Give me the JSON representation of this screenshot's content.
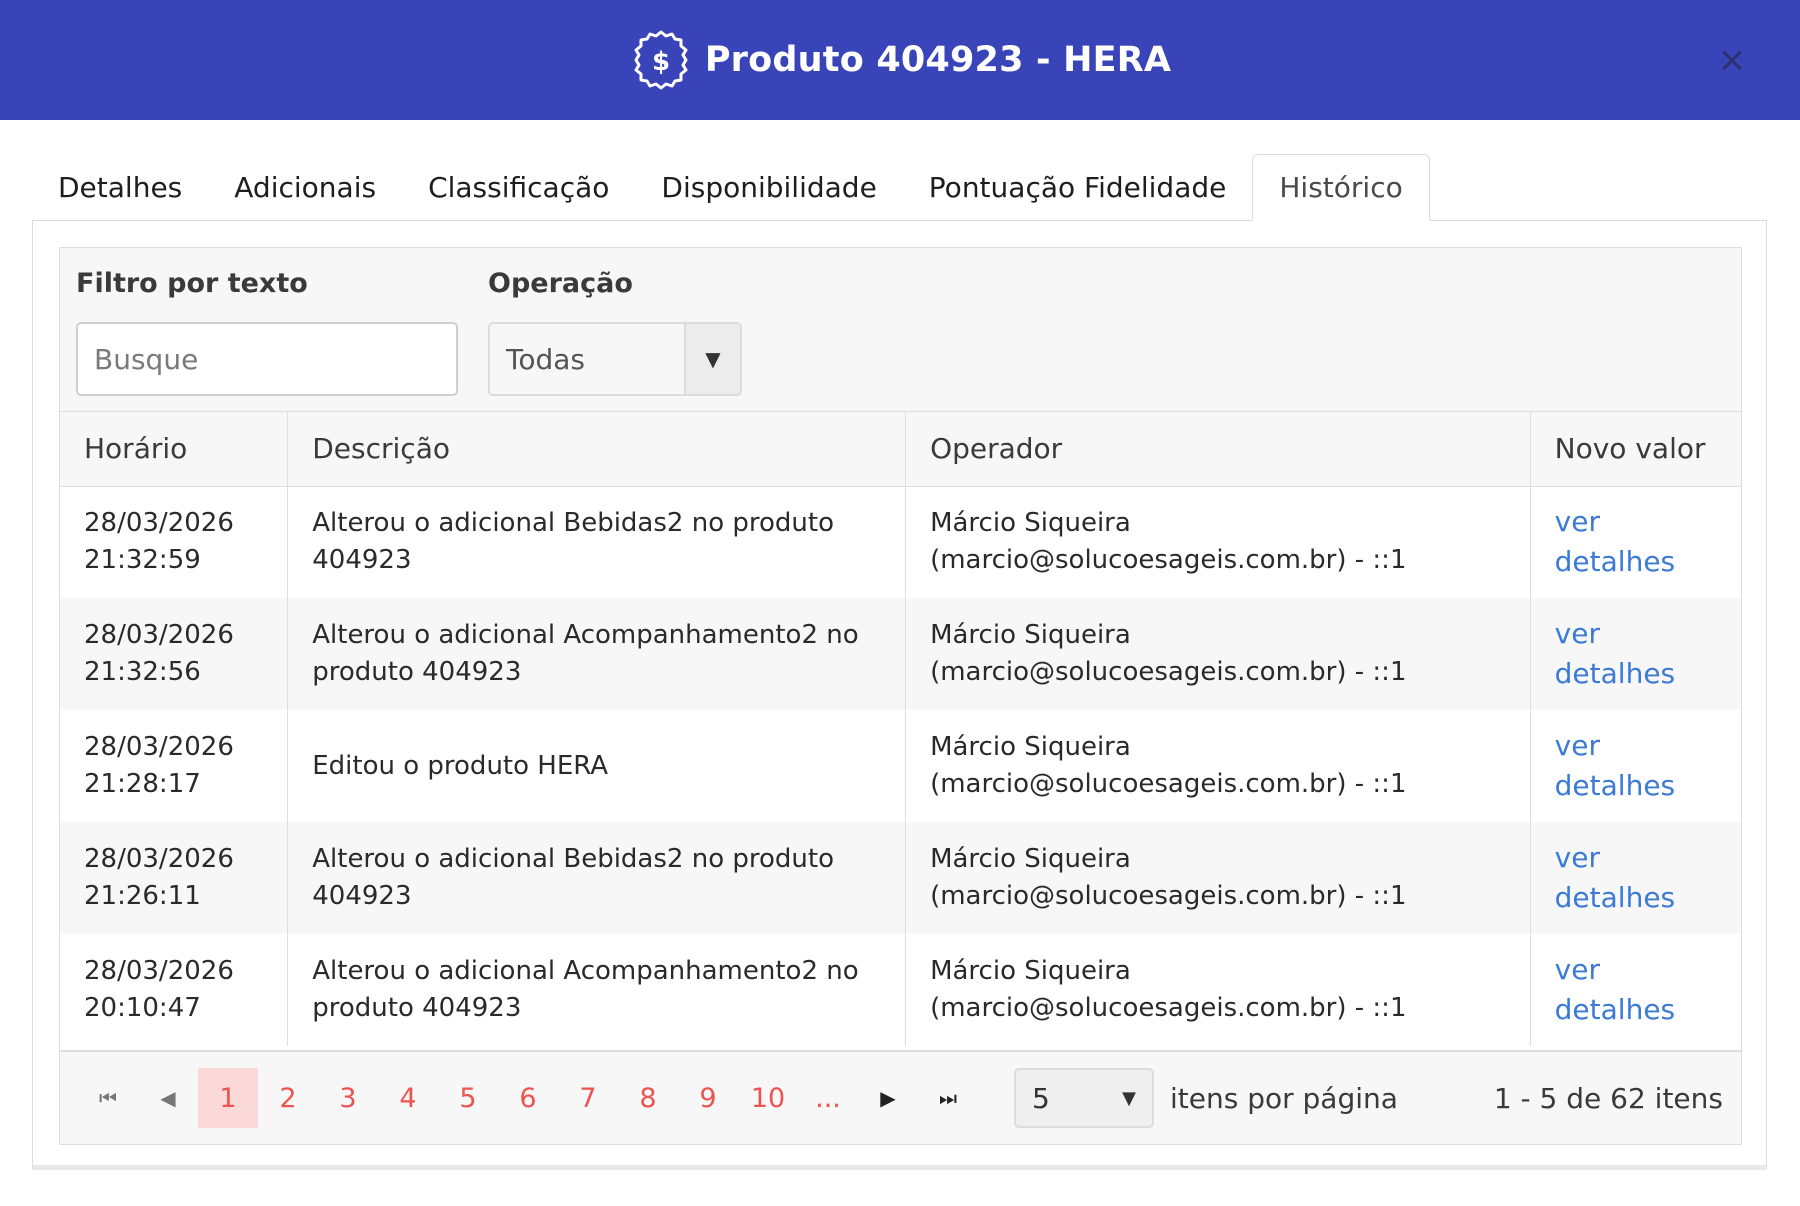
{
  "header": {
    "title": "Produto 404923 - HERA",
    "icon": "dollar-badge-icon",
    "close": "×"
  },
  "tabs": [
    {
      "label": "Detalhes",
      "active": false
    },
    {
      "label": "Adicionais",
      "active": false
    },
    {
      "label": "Classificação",
      "active": false
    },
    {
      "label": "Disponibilidade",
      "active": false
    },
    {
      "label": "Pontuação Fidelidade",
      "active": false
    },
    {
      "label": "Histórico",
      "active": true
    }
  ],
  "filters": {
    "text_label": "Filtro por texto",
    "text_placeholder": "Busque",
    "operation_label": "Operação",
    "operation_value": "Todas"
  },
  "table": {
    "columns": [
      "Horário",
      "Descrição",
      "Operador",
      "Novo valor"
    ],
    "link_label": {
      "line1": "ver",
      "line2": "detalhes"
    },
    "rows": [
      {
        "date": "28/03/2026",
        "time": "21:32:59",
        "desc1": "Alterou o adicional Bebidas2 no produto",
        "desc2": "404923",
        "op1": "Márcio Siqueira",
        "op2": "(marcio@solucoesageis.com.br) - ::1"
      },
      {
        "date": "28/03/2026",
        "time": "21:32:56",
        "desc1": "Alterou o adicional Acompanhamento2 no",
        "desc2": "produto 404923",
        "op1": "Márcio Siqueira",
        "op2": "(marcio@solucoesageis.com.br) - ::1"
      },
      {
        "date": "28/03/2026",
        "time": "21:28:17",
        "desc1": "Editou o produto HERA",
        "desc2": "",
        "op1": "Márcio Siqueira",
        "op2": "(marcio@solucoesageis.com.br) - ::1"
      },
      {
        "date": "28/03/2026",
        "time": "21:26:11",
        "desc1": "Alterou o adicional Bebidas2 no produto",
        "desc2": "404923",
        "op1": "Márcio Siqueira",
        "op2": "(marcio@solucoesageis.com.br) - ::1"
      },
      {
        "date": "28/03/2026",
        "time": "20:10:47",
        "desc1": "Alterou o adicional Acompanhamento2 no",
        "desc2": "produto 404923",
        "op1": "Márcio Siqueira",
        "op2": "(marcio@solucoesageis.com.br) - ::1"
      }
    ]
  },
  "pager": {
    "pages": [
      "1",
      "2",
      "3",
      "4",
      "5",
      "6",
      "7",
      "8",
      "9",
      "10",
      "..."
    ],
    "current": "1",
    "page_size": "5",
    "per_page_label": "itens por página",
    "summary": "1 - 5 de 62 itens"
  },
  "colors": {
    "header_bg": "#3a44b9",
    "link": "#3b7bd6",
    "pager_number": "#ef5350",
    "current_page_bg": "#fbd9d9"
  }
}
